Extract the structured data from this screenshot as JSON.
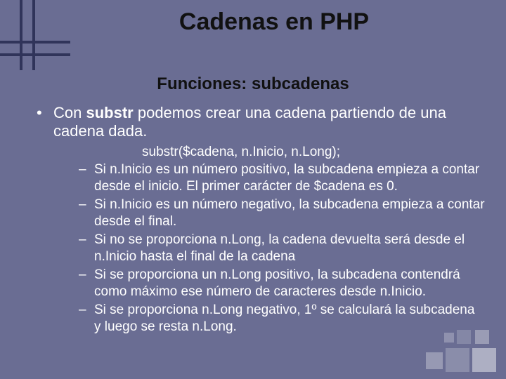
{
  "title": "Cadenas en PHP",
  "subtitle": "Funciones: subcadenas",
  "bullet": {
    "prefix": "Con ",
    "bold": "substr",
    "suffix": " podemos crear una cadena partiendo de una cadena dada."
  },
  "code": "substr($cadena, n.Inicio, n.Long);",
  "subitems": [
    "Si n.Inicio es un número positivo, la subcadena empieza a contar desde el inicio. El primer carácter de $cadena es 0.",
    "Si n.Inicio es un número negativo, la subcadena empieza a contar desde el final.",
    "Si no se proporciona n.Long, la cadena devuelta será desde el n.Inicio hasta el final de la cadena",
    "Si se proporciona un n.Long positivo, la subcadena contendrá como máximo ese número de caracteres desde n.Inicio.",
    "Si se proporciona n.Long negativo, 1º se calculará la subcadena y luego se resta n.Long."
  ]
}
